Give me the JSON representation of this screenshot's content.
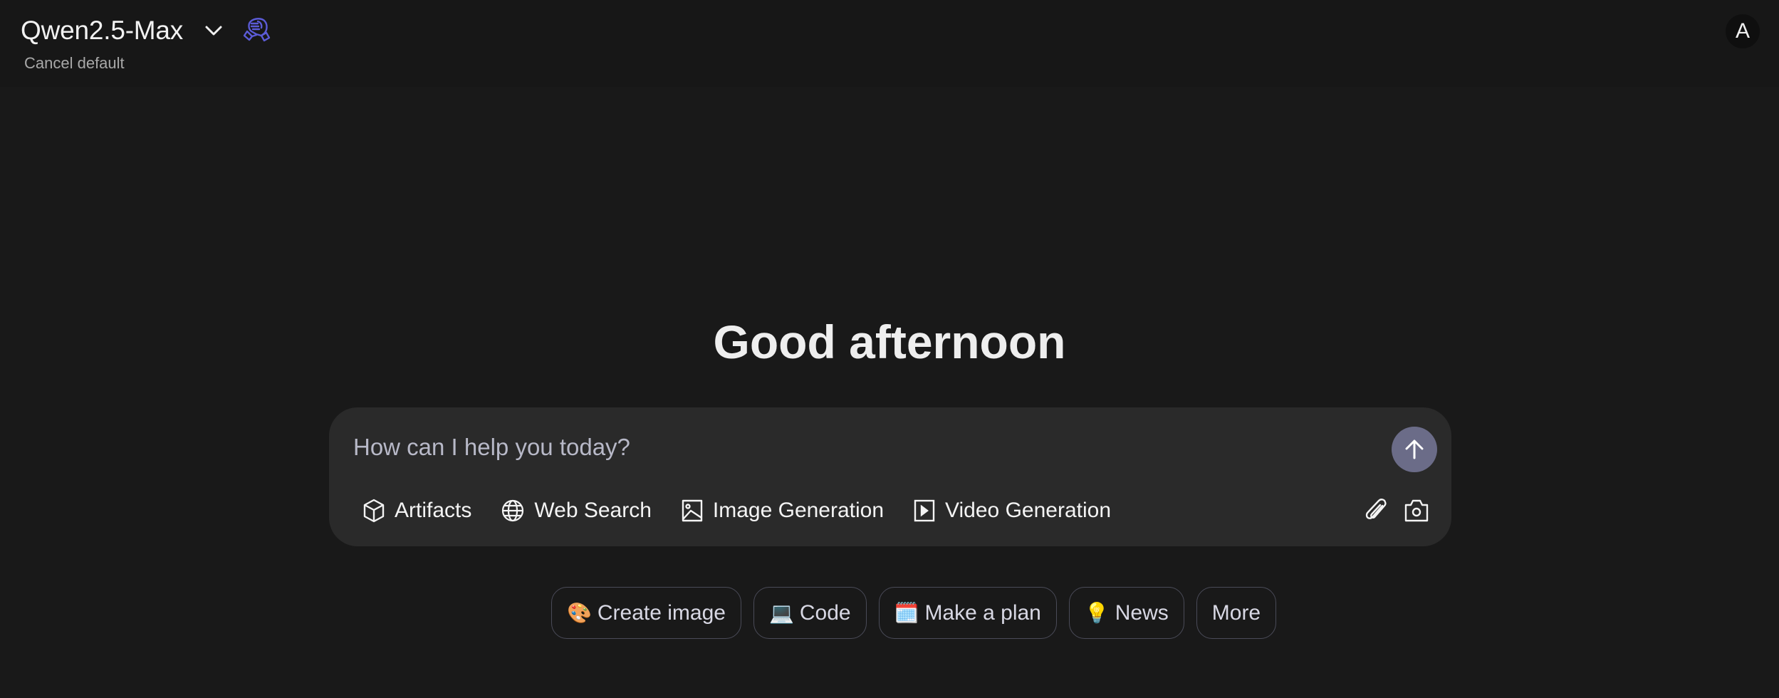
{
  "header": {
    "model_name": "Qwen2.5-Max",
    "chevron_icon": "chevron-down-icon",
    "badge_icon": "handshake-icon",
    "badge_color": "#5b5bd6",
    "cancel_default_label": "Cancel default",
    "avatar_initial": "A"
  },
  "main": {
    "greeting": "Good afternoon",
    "composer": {
      "placeholder": "How can I help you today?",
      "value": "",
      "send_icon": "arrow-up-icon",
      "send_button_color": "#6b6c88",
      "tools": [
        {
          "label": "Artifacts",
          "icon": "cube-icon"
        },
        {
          "label": "Web Search",
          "icon": "globe-icon"
        },
        {
          "label": "Image Generation",
          "icon": "image-icon"
        },
        {
          "label": "Video Generation",
          "icon": "video-play-icon"
        }
      ],
      "attach_icon": "paperclip-icon",
      "camera_icon": "camera-icon"
    },
    "suggestions": [
      {
        "emoji": "🎨",
        "label": "Create image"
      },
      {
        "emoji": "💻",
        "label": "Code"
      },
      {
        "emoji": "🗓️",
        "label": "Make a plan"
      },
      {
        "emoji": "💡",
        "label": "News"
      },
      {
        "emoji": "",
        "label": "More"
      }
    ]
  }
}
